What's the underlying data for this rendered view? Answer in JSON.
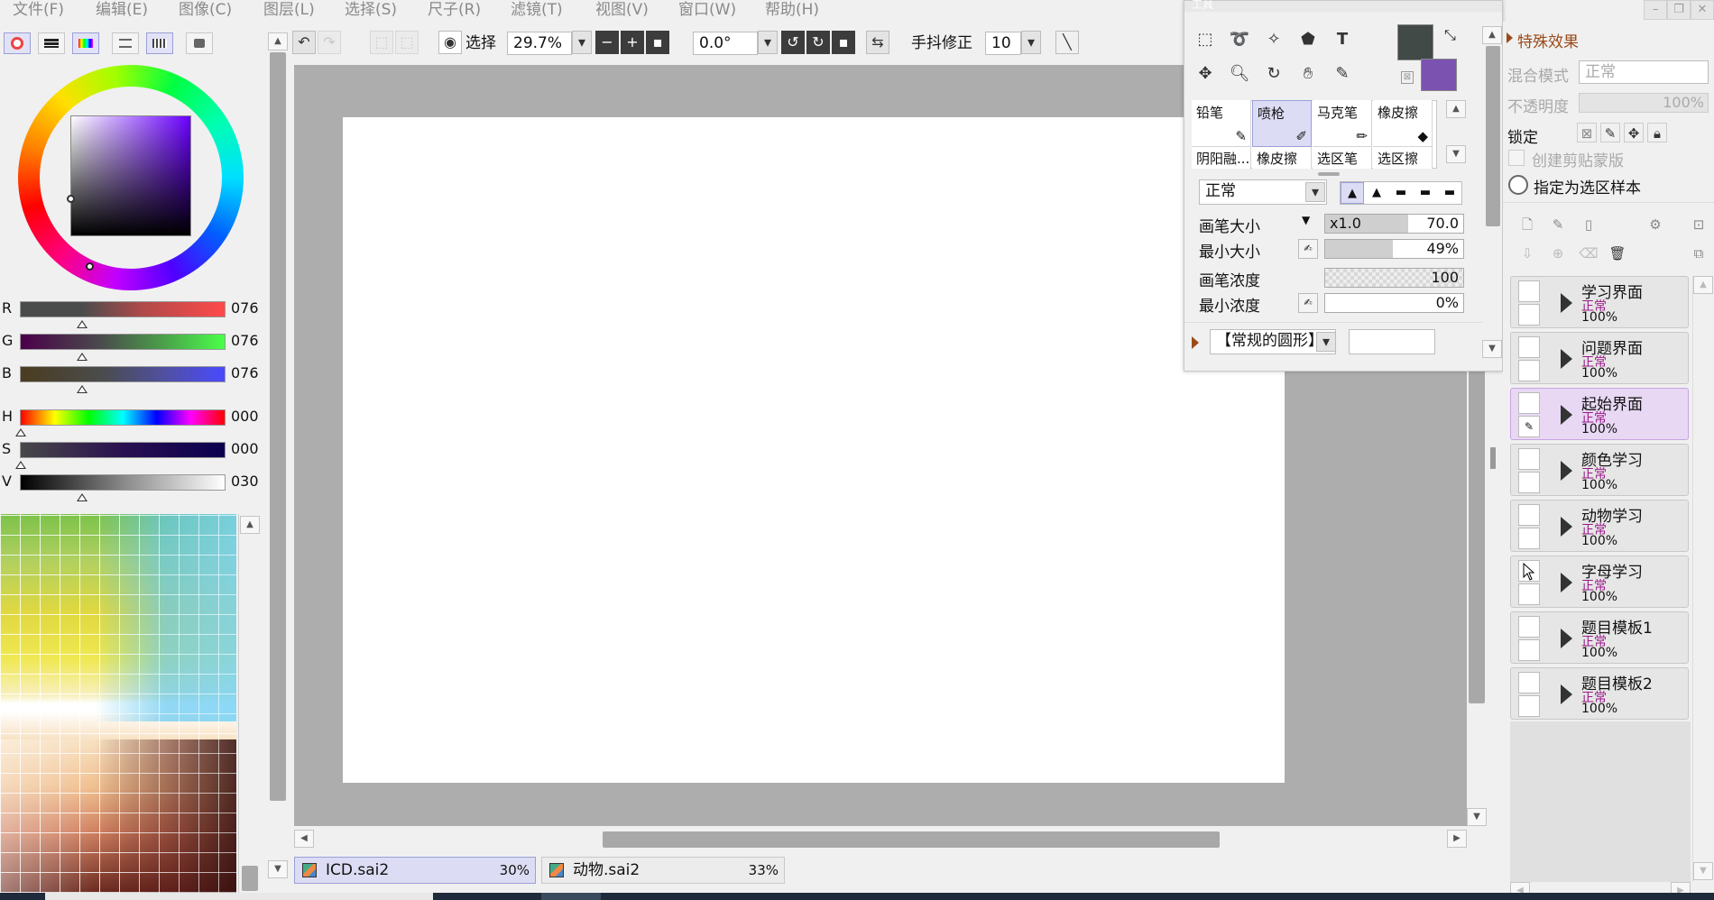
{
  "menu": [
    "文件(F)",
    "编辑(E)",
    "图像(C)",
    "图层(L)",
    "选择(S)",
    "尺子(R)",
    "滤镜(T)",
    "视图(V)",
    "窗口(W)",
    "帮助(H)"
  ],
  "toolbar": {
    "select_label": "选择",
    "zoom": "29.7%",
    "rotation": "0.0°",
    "stabilizer_label": "手抖修正",
    "stabilizer_value": "10"
  },
  "color_sliders": {
    "r": {
      "label": "R",
      "value": "076"
    },
    "g": {
      "label": "G",
      "value": "076"
    },
    "b": {
      "label": "B",
      "value": "076"
    },
    "h": {
      "label": "H",
      "value": "000"
    },
    "s": {
      "label": "S",
      "value": "000"
    },
    "v": {
      "label": "V",
      "value": "030"
    }
  },
  "colors": {
    "primary": "#414a47",
    "secondary": "#7b52b0"
  },
  "tool_panel": {
    "title": "工具",
    "tools": [
      "rect-select-icon",
      "lasso-icon",
      "magic-wand-icon",
      "shape-icon",
      "text-icon",
      "move-icon",
      "zoom-icon",
      "rotate-icon",
      "hand-icon",
      "eyedropper-icon"
    ],
    "brushes_row1": [
      "铅笔",
      "喷枪",
      "马克笔",
      "橡皮擦"
    ],
    "brushes_row2": [
      "阴阳融...",
      "橡皮擦",
      "选区笔",
      "选区擦"
    ],
    "blend_mode": "正常",
    "brush_size_label": "画笔大小",
    "brush_size_mult": "x1.0",
    "brush_size_value": "70.0",
    "min_size_label": "最小大小",
    "min_size_value": "49%",
    "density_label": "画笔浓度",
    "density_value": "100",
    "min_density_label": "最小浓度",
    "min_density_value": "0%",
    "brush_shape": "【常规的圆形】"
  },
  "right_panel": {
    "effects_label": "特殊效果",
    "blend_label": "混合模式",
    "blend_value": "正常",
    "opacity_label": "不透明度",
    "opacity_value": "100%",
    "lock_label": "锁定",
    "clip_label": "创建剪贴蒙版",
    "sample_label": "指定为选区样本"
  },
  "layers": [
    {
      "name": "学习界面",
      "mode": "正常",
      "opacity": "100%"
    },
    {
      "name": "问题界面",
      "mode": "正常",
      "opacity": "100%"
    },
    {
      "name": "起始界面",
      "mode": "正常",
      "opacity": "100%"
    },
    {
      "name": "颜色学习",
      "mode": "正常",
      "opacity": "100%"
    },
    {
      "name": "动物学习",
      "mode": "正常",
      "opacity": "100%"
    },
    {
      "name": "字母学习",
      "mode": "正常",
      "opacity": "100%"
    },
    {
      "name": "题目模板1",
      "mode": "正常",
      "opacity": "100%"
    },
    {
      "name": "题目模板2",
      "mode": "正常",
      "opacity": "100%"
    }
  ],
  "documents": [
    {
      "name": "ICD.sai2",
      "zoom": "30%"
    },
    {
      "name": "动物.sai2",
      "zoom": "33%"
    }
  ]
}
